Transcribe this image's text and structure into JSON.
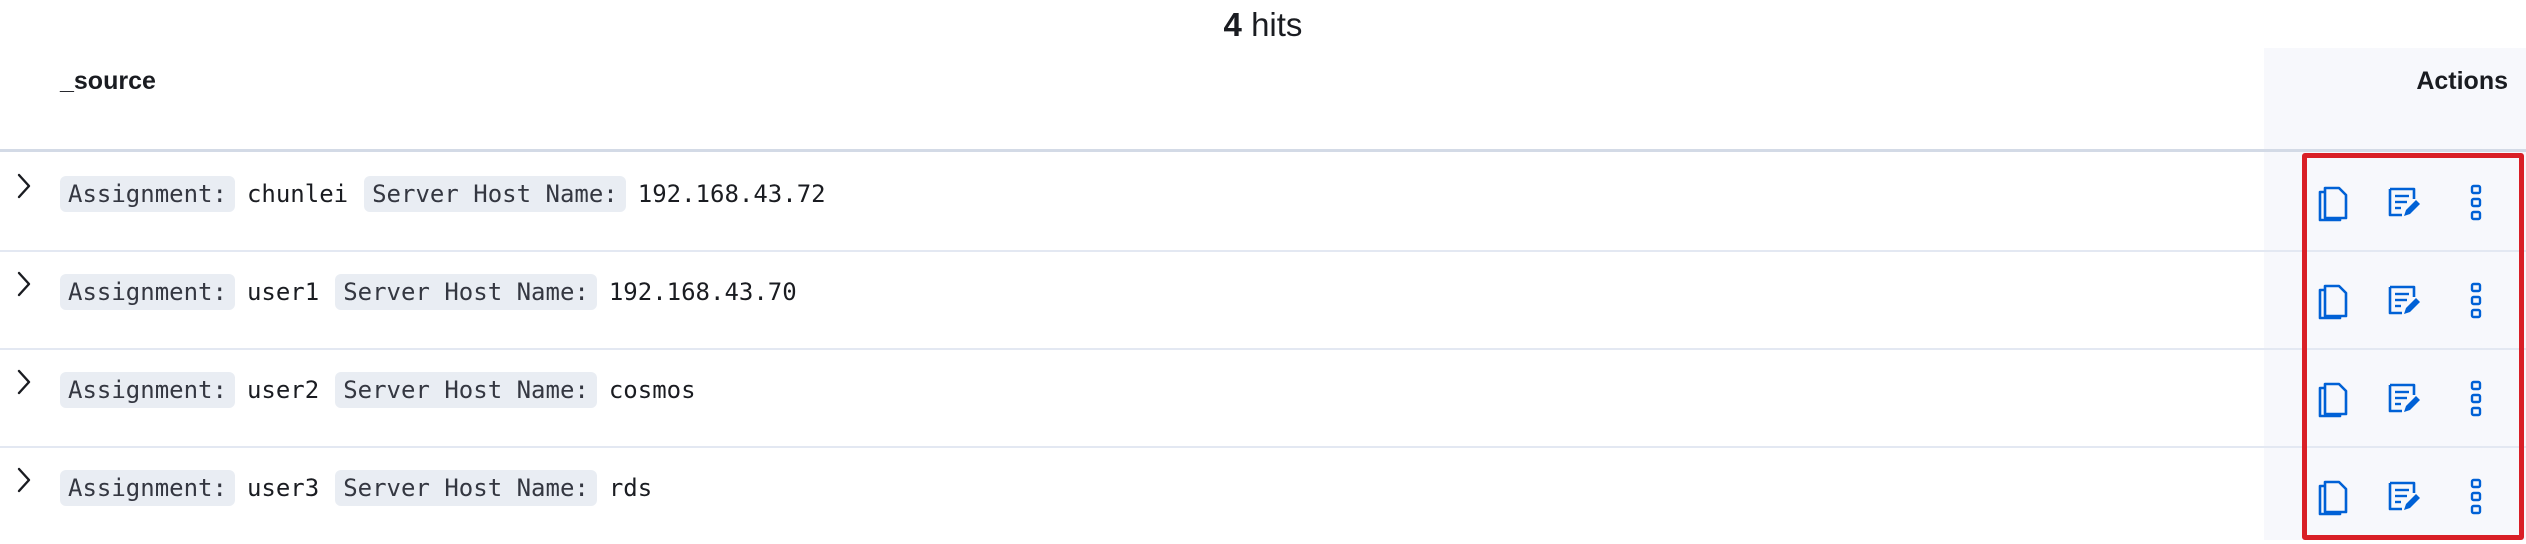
{
  "hits": {
    "count": "4",
    "label": "hits"
  },
  "columns": {
    "source": "_source",
    "actions": "Actions"
  },
  "rows": [
    {
      "fields": [
        {
          "key": "Assignment:",
          "value": "chunlei"
        },
        {
          "key": "Server Host Name:",
          "value": "192.168.43.72"
        }
      ]
    },
    {
      "fields": [
        {
          "key": "Assignment:",
          "value": "user1"
        },
        {
          "key": "Server Host Name:",
          "value": "192.168.43.70"
        }
      ]
    },
    {
      "fields": [
        {
          "key": "Assignment:",
          "value": "user2"
        },
        {
          "key": "Server Host Name:",
          "value": "cosmos"
        }
      ]
    },
    {
      "fields": [
        {
          "key": "Assignment:",
          "value": "user3"
        },
        {
          "key": "Server Host Name:",
          "value": "rds"
        }
      ]
    }
  ],
  "icons": {
    "expand": "chevron-right-icon",
    "copy": "copy-document-icon",
    "edit": "edit-document-icon",
    "more": "more-vertical-icon"
  },
  "colors": {
    "accent": "#0061d6",
    "highlight": "#d91f26",
    "pill_bg": "#e9edf3",
    "actions_bg": "#f7f8fc"
  }
}
